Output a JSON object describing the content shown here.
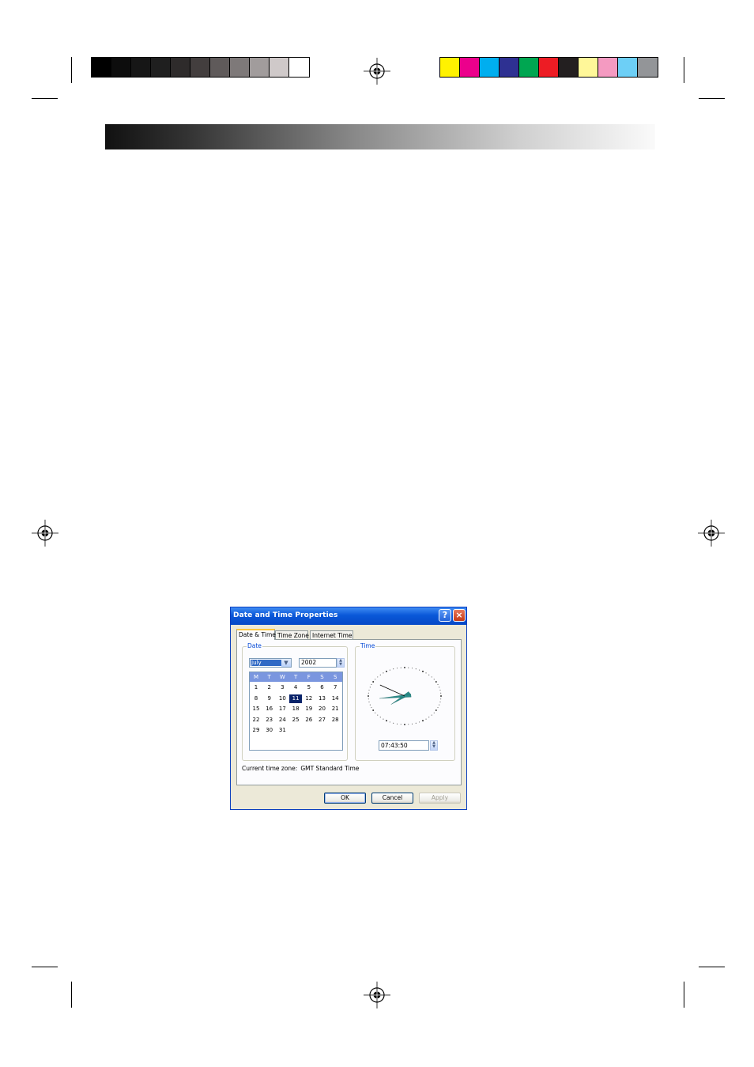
{
  "print_marks": {
    "gray_swatches": [
      "#000000",
      "#0d0d0d",
      "#161616",
      "#1f1f1f",
      "#2e2b2b",
      "#433e3e",
      "#5f5a5a",
      "#7e7979",
      "#a19c9c",
      "#cfc9c9",
      "#ffffff"
    ],
    "color_swatches": [
      "#fff200",
      "#ec008c",
      "#00aeef",
      "#2e3192",
      "#00a651",
      "#ed1c24",
      "#231f20",
      "#fff799",
      "#f49ac1",
      "#6dcff6",
      "#939598"
    ]
  },
  "dialog": {
    "title": "Date and Time Properties",
    "help_label": "?",
    "close_label": "×",
    "tabs": [
      {
        "label": "Date & Time",
        "active": true
      },
      {
        "label": "Time Zone",
        "active": false
      },
      {
        "label": "Internet Time",
        "active": false
      }
    ],
    "date_group": {
      "label": "Date",
      "month": "July",
      "year": "2002",
      "weekday_headers": [
        "M",
        "T",
        "W",
        "T",
        "F",
        "S",
        "S"
      ],
      "weeks": [
        [
          "1",
          "2",
          "3",
          "4",
          "5",
          "6",
          "7"
        ],
        [
          "8",
          "9",
          "10",
          "11",
          "12",
          "13",
          "14"
        ],
        [
          "15",
          "16",
          "17",
          "18",
          "19",
          "20",
          "21"
        ],
        [
          "22",
          "23",
          "24",
          "25",
          "26",
          "27",
          "28"
        ],
        [
          "29",
          "30",
          "31",
          "",
          "",
          "",
          ""
        ]
      ],
      "selected_day": "11"
    },
    "time_group": {
      "label": "Time",
      "time_value": "07:43:50",
      "clock": {
        "hour": 7,
        "minute": 43,
        "second": 50,
        "hand_color": "#2a8d8a"
      }
    },
    "timezone": {
      "label": "Current time zone:",
      "value": "GMT Standard Time"
    },
    "buttons": {
      "ok": "OK",
      "cancel": "Cancel",
      "apply": "Apply"
    }
  }
}
